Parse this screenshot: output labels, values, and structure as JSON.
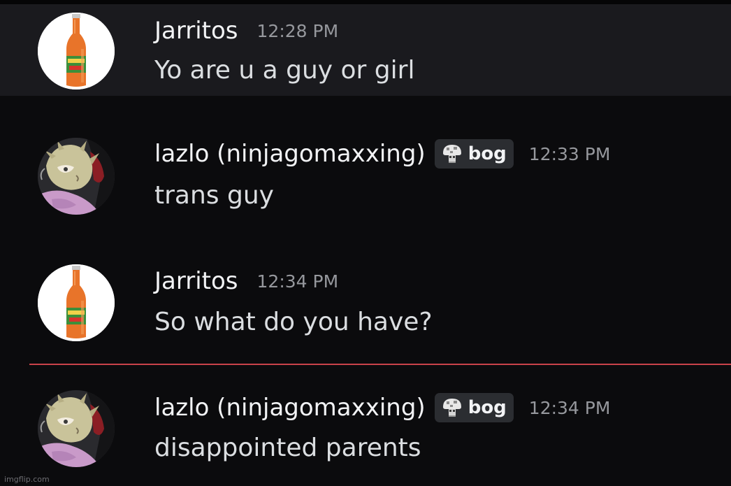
{
  "messages": [
    {
      "author": "Jarritos",
      "timestamp": "12:28 PM",
      "text": "Yo are u a guy or girl",
      "avatar_icon": "soda-bottle-icon",
      "role": null,
      "highlighted": true
    },
    {
      "author": "lazlo (ninjagomaxxing)",
      "timestamp": "12:33 PM",
      "text": "trans guy",
      "avatar_icon": "anime-character-icon",
      "role": {
        "label": "bog",
        "icon": "mushroom-icon"
      },
      "highlighted": false
    },
    {
      "author": "Jarritos",
      "timestamp": "12:34 PM",
      "text": "So what do you have?",
      "avatar_icon": "soda-bottle-icon",
      "role": null,
      "highlighted": false
    },
    {
      "author": "lazlo (ninjagomaxxing)",
      "timestamp": "12:34 PM",
      "text": "disappointed parents",
      "avatar_icon": "anime-character-icon",
      "role": {
        "label": "bog",
        "icon": "mushroom-icon"
      },
      "highlighted": false
    }
  ],
  "new_messages_divider_color": "#c9424a",
  "watermark": "imgflip.com"
}
